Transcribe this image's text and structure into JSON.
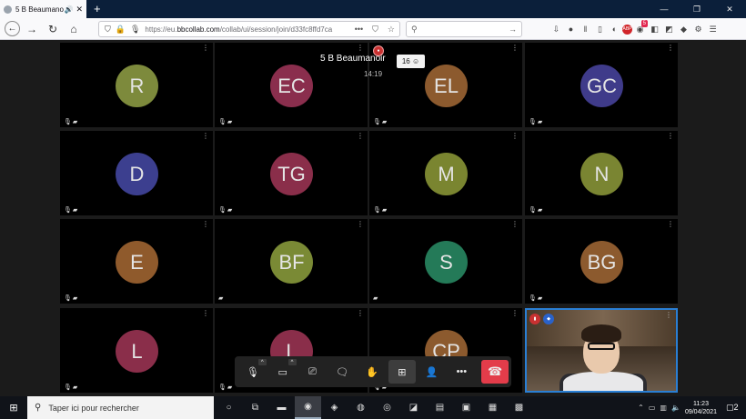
{
  "browser": {
    "tab_title": "5 B Beaumanoir",
    "tab_audio_icon": "speaker-icon",
    "tab_close": "✕",
    "new_tab": "+",
    "window_controls": [
      "—",
      "❐",
      "✕"
    ],
    "url_prefix": "https://eu.",
    "url_domain": "bbcollab.com",
    "url_rest": "/collab/ui/session/join/d33fc8ffd7ca",
    "url_more": "•••",
    "toolbar_badge": "5"
  },
  "session": {
    "title": "5 B Beaumanoir",
    "time": "14:19",
    "participant_count": "16",
    "participant_icon": "people-icon"
  },
  "tiles": [
    {
      "initials": "R",
      "color": "#7d8a3c",
      "mic_off": true,
      "cam_off": true
    },
    {
      "initials": "EC",
      "color": "#8a2e4d",
      "mic_off": true,
      "cam_off": true
    },
    {
      "initials": "EL",
      "color": "#8c5a2e",
      "mic_off": true,
      "cam_off": true
    },
    {
      "initials": "GC",
      "color": "#3f3b8a",
      "mic_off": true,
      "cam_off": true
    },
    {
      "initials": "D",
      "color": "#3c3f8f",
      "mic_off": true,
      "cam_off": true
    },
    {
      "initials": "TG",
      "color": "#8a2e4a",
      "mic_off": true,
      "cam_off": true
    },
    {
      "initials": "M",
      "color": "#7a8530",
      "mic_off": true,
      "cam_off": true
    },
    {
      "initials": "N",
      "color": "#7a8532",
      "mic_off": true,
      "cam_off": true
    },
    {
      "initials": "E",
      "color": "#8f5a2c",
      "mic_off": true,
      "cam_off": true
    },
    {
      "initials": "BF",
      "color": "#7a8a35",
      "mic_off": false,
      "cam_off": true
    },
    {
      "initials": "S",
      "color": "#247a58",
      "mic_off": false,
      "cam_off": true
    },
    {
      "initials": "BG",
      "color": "#8c5a2e",
      "mic_off": true,
      "cam_off": true
    },
    {
      "initials": "L",
      "color": "#8a2e4a",
      "mic_off": true,
      "cam_off": true
    },
    {
      "initials": "L",
      "color": "#8a2e4a",
      "mic_off": true,
      "cam_off": true
    },
    {
      "initials": "CP",
      "color": "#8c5a2e",
      "mic_off": true,
      "cam_off": true
    },
    {
      "initials": "",
      "color": "",
      "mic_off": false,
      "cam_off": false,
      "self": true
    }
  ],
  "controls": [
    {
      "name": "microphone-button",
      "icon": "microphone-icon",
      "glyph": "🎙",
      "caret": true
    },
    {
      "name": "camera-button",
      "icon": "camera-icon",
      "glyph": "▭",
      "caret": true
    },
    {
      "name": "share-screen-button",
      "icon": "share-screen-icon",
      "glyph": "⎚"
    },
    {
      "name": "chat-button",
      "icon": "chat-icon",
      "glyph": "🗨"
    },
    {
      "name": "raise-hand-button",
      "icon": "hand-icon",
      "glyph": "✋"
    },
    {
      "name": "grid-view-button",
      "icon": "grid-icon",
      "glyph": "⊞",
      "active": true
    },
    {
      "name": "participants-button",
      "icon": "person-icon",
      "glyph": "👤"
    },
    {
      "name": "more-button",
      "icon": "more-icon",
      "glyph": "•••"
    },
    {
      "name": "end-call-button",
      "icon": "hang-up-icon",
      "glyph": "☎",
      "end": true
    }
  ],
  "taskbar": {
    "search_placeholder": "Taper ici pour rechercher",
    "time": "11:23",
    "date": "09/04/2021",
    "notifications": "2"
  }
}
